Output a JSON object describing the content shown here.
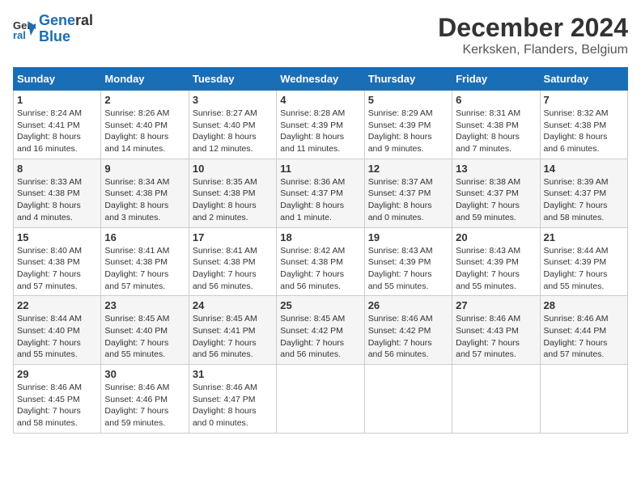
{
  "header": {
    "logo_line1": "General",
    "logo_line2": "Blue",
    "title": "December 2024",
    "subtitle": "Kerksken, Flanders, Belgium"
  },
  "calendar": {
    "headers": [
      "Sunday",
      "Monday",
      "Tuesday",
      "Wednesday",
      "Thursday",
      "Friday",
      "Saturday"
    ],
    "weeks": [
      [
        {
          "day": "",
          "info": ""
        },
        {
          "day": "2",
          "info": "Sunrise: 8:26 AM\nSunset: 4:40 PM\nDaylight: 8 hours\nand 14 minutes."
        },
        {
          "day": "3",
          "info": "Sunrise: 8:27 AM\nSunset: 4:40 PM\nDaylight: 8 hours\nand 12 minutes."
        },
        {
          "day": "4",
          "info": "Sunrise: 8:28 AM\nSunset: 4:39 PM\nDaylight: 8 hours\nand 11 minutes."
        },
        {
          "day": "5",
          "info": "Sunrise: 8:29 AM\nSunset: 4:39 PM\nDaylight: 8 hours\nand 9 minutes."
        },
        {
          "day": "6",
          "info": "Sunrise: 8:31 AM\nSunset: 4:38 PM\nDaylight: 8 hours\nand 7 minutes."
        },
        {
          "day": "7",
          "info": "Sunrise: 8:32 AM\nSunset: 4:38 PM\nDaylight: 8 hours\nand 6 minutes."
        }
      ],
      [
        {
          "day": "1",
          "info": "Sunrise: 8:24 AM\nSunset: 4:41 PM\nDaylight: 8 hours\nand 16 minutes."
        },
        null,
        null,
        null,
        null,
        null,
        null
      ],
      [
        {
          "day": "8",
          "info": "Sunrise: 8:33 AM\nSunset: 4:38 PM\nDaylight: 8 hours\nand 4 minutes."
        },
        {
          "day": "9",
          "info": "Sunrise: 8:34 AM\nSunset: 4:38 PM\nDaylight: 8 hours\nand 3 minutes."
        },
        {
          "day": "10",
          "info": "Sunrise: 8:35 AM\nSunset: 4:38 PM\nDaylight: 8 hours\nand 2 minutes."
        },
        {
          "day": "11",
          "info": "Sunrise: 8:36 AM\nSunset: 4:37 PM\nDaylight: 8 hours\nand 1 minute."
        },
        {
          "day": "12",
          "info": "Sunrise: 8:37 AM\nSunset: 4:37 PM\nDaylight: 8 hours\nand 0 minutes."
        },
        {
          "day": "13",
          "info": "Sunrise: 8:38 AM\nSunset: 4:37 PM\nDaylight: 7 hours\nand 59 minutes."
        },
        {
          "day": "14",
          "info": "Sunrise: 8:39 AM\nSunset: 4:37 PM\nDaylight: 7 hours\nand 58 minutes."
        }
      ],
      [
        {
          "day": "15",
          "info": "Sunrise: 8:40 AM\nSunset: 4:38 PM\nDaylight: 7 hours\nand 57 minutes."
        },
        {
          "day": "16",
          "info": "Sunrise: 8:41 AM\nSunset: 4:38 PM\nDaylight: 7 hours\nand 57 minutes."
        },
        {
          "day": "17",
          "info": "Sunrise: 8:41 AM\nSunset: 4:38 PM\nDaylight: 7 hours\nand 56 minutes."
        },
        {
          "day": "18",
          "info": "Sunrise: 8:42 AM\nSunset: 4:38 PM\nDaylight: 7 hours\nand 56 minutes."
        },
        {
          "day": "19",
          "info": "Sunrise: 8:43 AM\nSunset: 4:39 PM\nDaylight: 7 hours\nand 55 minutes."
        },
        {
          "day": "20",
          "info": "Sunrise: 8:43 AM\nSunset: 4:39 PM\nDaylight: 7 hours\nand 55 minutes."
        },
        {
          "day": "21",
          "info": "Sunrise: 8:44 AM\nSunset: 4:39 PM\nDaylight: 7 hours\nand 55 minutes."
        }
      ],
      [
        {
          "day": "22",
          "info": "Sunrise: 8:44 AM\nSunset: 4:40 PM\nDaylight: 7 hours\nand 55 minutes."
        },
        {
          "day": "23",
          "info": "Sunrise: 8:45 AM\nSunset: 4:40 PM\nDaylight: 7 hours\nand 55 minutes."
        },
        {
          "day": "24",
          "info": "Sunrise: 8:45 AM\nSunset: 4:41 PM\nDaylight: 7 hours\nand 56 minutes."
        },
        {
          "day": "25",
          "info": "Sunrise: 8:45 AM\nSunset: 4:42 PM\nDaylight: 7 hours\nand 56 minutes."
        },
        {
          "day": "26",
          "info": "Sunrise: 8:46 AM\nSunset: 4:42 PM\nDaylight: 7 hours\nand 56 minutes."
        },
        {
          "day": "27",
          "info": "Sunrise: 8:46 AM\nSunset: 4:43 PM\nDaylight: 7 hours\nand 57 minutes."
        },
        {
          "day": "28",
          "info": "Sunrise: 8:46 AM\nSunset: 4:44 PM\nDaylight: 7 hours\nand 57 minutes."
        }
      ],
      [
        {
          "day": "29",
          "info": "Sunrise: 8:46 AM\nSunset: 4:45 PM\nDaylight: 7 hours\nand 58 minutes."
        },
        {
          "day": "30",
          "info": "Sunrise: 8:46 AM\nSunset: 4:46 PM\nDaylight: 7 hours\nand 59 minutes."
        },
        {
          "day": "31",
          "info": "Sunrise: 8:46 AM\nSunset: 4:47 PM\nDaylight: 8 hours\nand 0 minutes."
        },
        {
          "day": "",
          "info": ""
        },
        {
          "day": "",
          "info": ""
        },
        {
          "day": "",
          "info": ""
        },
        {
          "day": "",
          "info": ""
        }
      ]
    ]
  }
}
